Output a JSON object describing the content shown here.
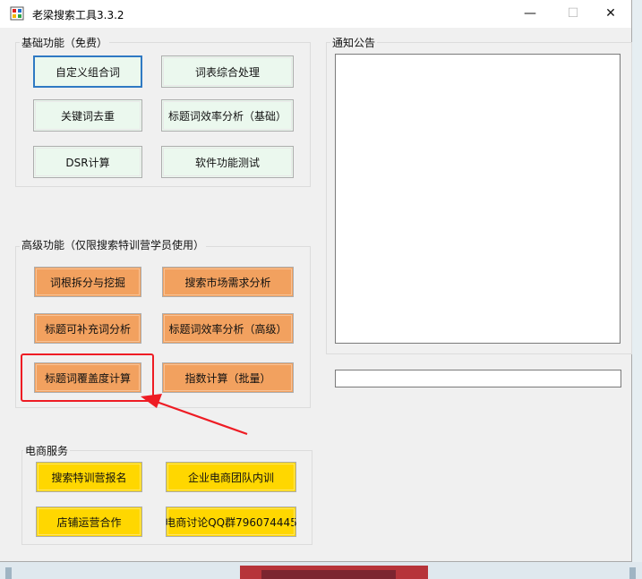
{
  "window": {
    "title": "老梁搜索工具3.3.2",
    "controls": {
      "minimize": "—",
      "maximize": "☐",
      "close": "✕"
    }
  },
  "basic": {
    "label": "基础功能（免费）",
    "buttons": [
      "自定义组合词",
      "词表综合处理",
      "关键词去重",
      "标题词效率分析（基础）",
      "DSR计算",
      "软件功能测试"
    ]
  },
  "advanced": {
    "label": "高级功能（仅限搜索特训营学员使用）",
    "buttons": [
      "词根拆分与挖掘",
      "搜索市场需求分析",
      "标题可补充词分析",
      "标题词效率分析（高级）",
      "标题词覆盖度计算",
      "指数计算（批量）"
    ]
  },
  "ecommerce": {
    "label": "电商服务",
    "buttons": [
      "搜索特训营报名",
      "企业电商团队内训",
      "店铺运营合作",
      "电商讨论QQ群796074445"
    ]
  },
  "notice": {
    "label": "通知公告",
    "content": ""
  },
  "status": {
    "value": ""
  },
  "colors": {
    "advanced_button": "#f2a15f",
    "ecommerce_button": "#ffd700",
    "basic_button": "#ebf8ee",
    "highlight": "#ee1c24"
  }
}
